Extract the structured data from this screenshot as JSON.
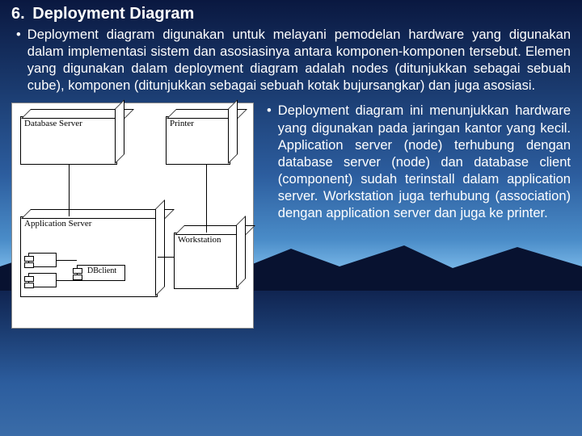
{
  "heading_number": "6.",
  "heading_title": "Deployment Diagram",
  "bullet1": "Deployment diagram digunakan untuk melayani pemodelan hardware yang digunakan dalam implementasi sistem dan asosiasinya antara komponen-komponen tersebut. Elemen yang digunakan dalam deployment diagram adalah nodes (ditunjukkan sebagai sebuah cube), komponen (ditunjukkan sebagai sebuah kotak bujursangkar) dan juga asosiasi.",
  "bullet2": "Deployment diagram ini menunjukkan hardware yang digunakan pada jaringan kantor yang kecil. Application server (node) terhubung dengan database server (node) dan database client (component) sudah terinstall dalam application server. Workstation juga terhubung (association) dengan application server dan juga ke printer.",
  "diagram": {
    "database_server": "Database Server",
    "printer": "Printer",
    "application_server": "Application Server",
    "workstation": "Workstation",
    "dbclient": "DBclient"
  }
}
